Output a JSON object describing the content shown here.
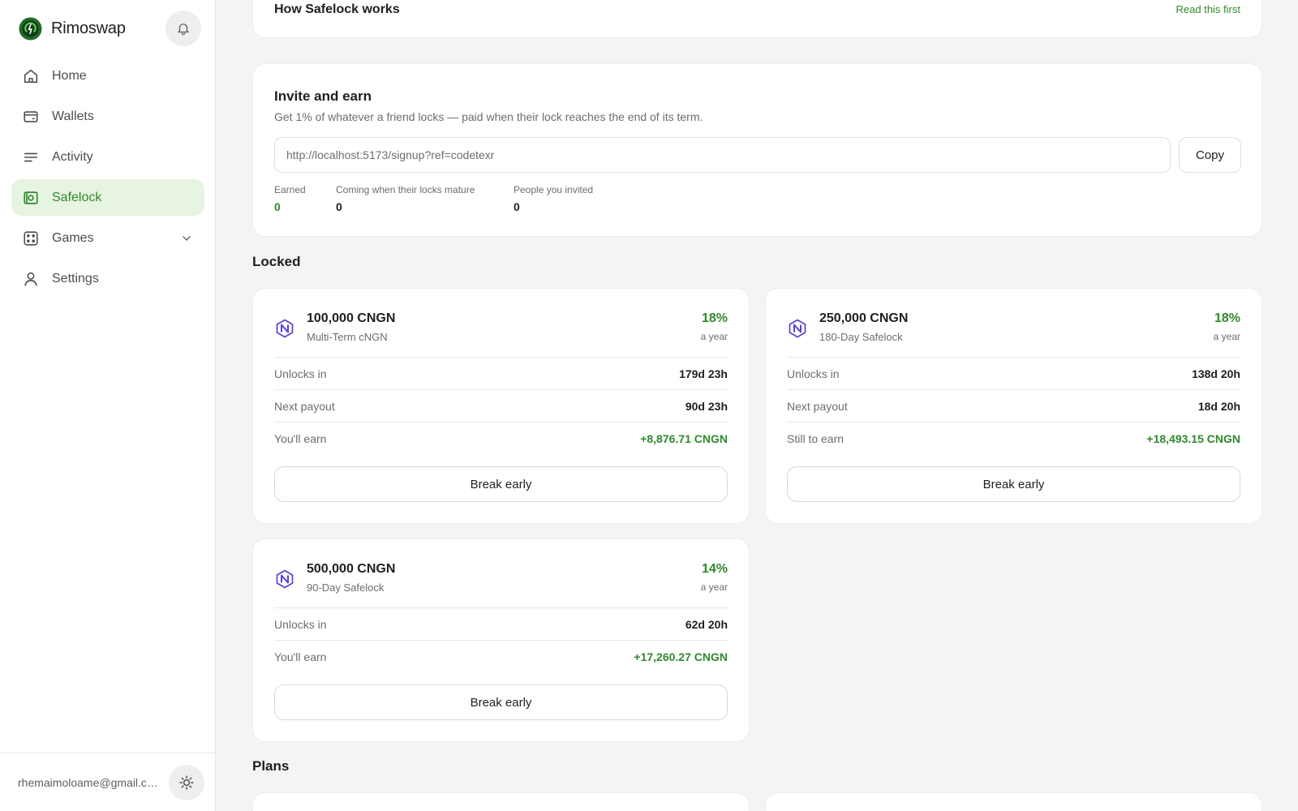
{
  "app": {
    "name": "Rimoswap"
  },
  "sidebar": {
    "items": [
      {
        "label": "Home",
        "icon": "home-icon"
      },
      {
        "label": "Wallets",
        "icon": "wallet-icon"
      },
      {
        "label": "Activity",
        "icon": "activity-icon"
      },
      {
        "label": "Safelock",
        "icon": "safelock-icon",
        "active": true
      },
      {
        "label": "Games",
        "icon": "games-icon"
      },
      {
        "label": "Settings",
        "icon": "user-icon"
      }
    ],
    "user_email": "rhemaimoloame@gmail.co..."
  },
  "how_it_works": {
    "title": "How Safelock works",
    "link": "Read this first"
  },
  "invite": {
    "title": "Invite and earn",
    "description": "Get 1% of whatever a friend locks — paid when their lock reaches the end of its term.",
    "referral_link": "http://localhost:5173/signup?ref=codetexr",
    "copy_label": "Copy",
    "stats": [
      {
        "label": "Earned",
        "value": "0"
      },
      {
        "label": "Coming when their locks mature",
        "value": "0"
      },
      {
        "label": "People you invited",
        "value": "0"
      }
    ]
  },
  "locked": {
    "title": "Locked",
    "locks": [
      {
        "amount": "100,000 CNGN",
        "plan": "Multi-Term cNGN",
        "rate": "18%",
        "rate_period": "a year",
        "rows": [
          {
            "label": "Unlocks in",
            "value": "179d 23h"
          },
          {
            "label": "Next payout",
            "value": "90d 23h"
          },
          {
            "label": "You'll earn",
            "value": "+8,876.71 CNGN"
          }
        ],
        "action": "Break early"
      },
      {
        "amount": "250,000 CNGN",
        "plan": "180-Day Safelock",
        "rate": "18%",
        "rate_period": "a year",
        "rows": [
          {
            "label": "Unlocks in",
            "value": "138d 20h"
          },
          {
            "label": "Next payout",
            "value": "18d 20h"
          },
          {
            "label": "Still to earn",
            "value": "+18,493.15 CNGN"
          }
        ],
        "action": "Break early"
      },
      {
        "amount": "500,000 CNGN",
        "plan": "90-Day Safelock",
        "rate": "14%",
        "rate_period": "a year",
        "rows": [
          {
            "label": "Unlocks in",
            "value": "62d 20h"
          },
          {
            "label": "You'll earn",
            "value": "+17,260.27 CNGN"
          }
        ],
        "action": "Break early"
      }
    ]
  },
  "plans": {
    "title": "Plans"
  },
  "colors": {
    "accent": "#2f8a2c",
    "active_bg": "#e6f4e1",
    "token": "#5b3fd6"
  }
}
